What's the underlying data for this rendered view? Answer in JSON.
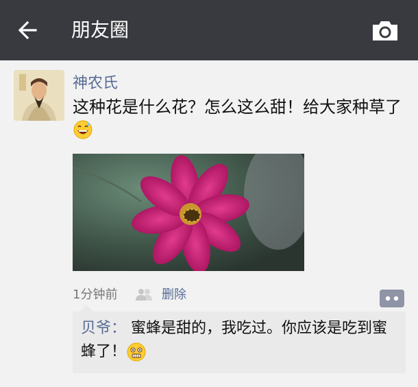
{
  "header": {
    "title": "朋友圈",
    "back_icon": "back-arrow-icon",
    "camera_icon": "camera-icon",
    "background_color": "#393a3f"
  },
  "post": {
    "username": "神农氏",
    "text": "这种花是什么花？怎么这么甜！给大家种草了",
    "emoji": "grinning-sweat-emoji",
    "photo": "pink-flower-with-bee",
    "time": "1分钟前",
    "visibility_icon": "friends-icon",
    "delete_label": "删除"
  },
  "comment": {
    "author": "贝爷：",
    "text": "蜜蜂是甜的，我吃过。你应该是吃到蜜蜂了！",
    "emoji": "grimace-emoji"
  },
  "colors": {
    "link": "#576b95",
    "background": "#f2f2f2",
    "comment_bg": "#eaeaea"
  }
}
